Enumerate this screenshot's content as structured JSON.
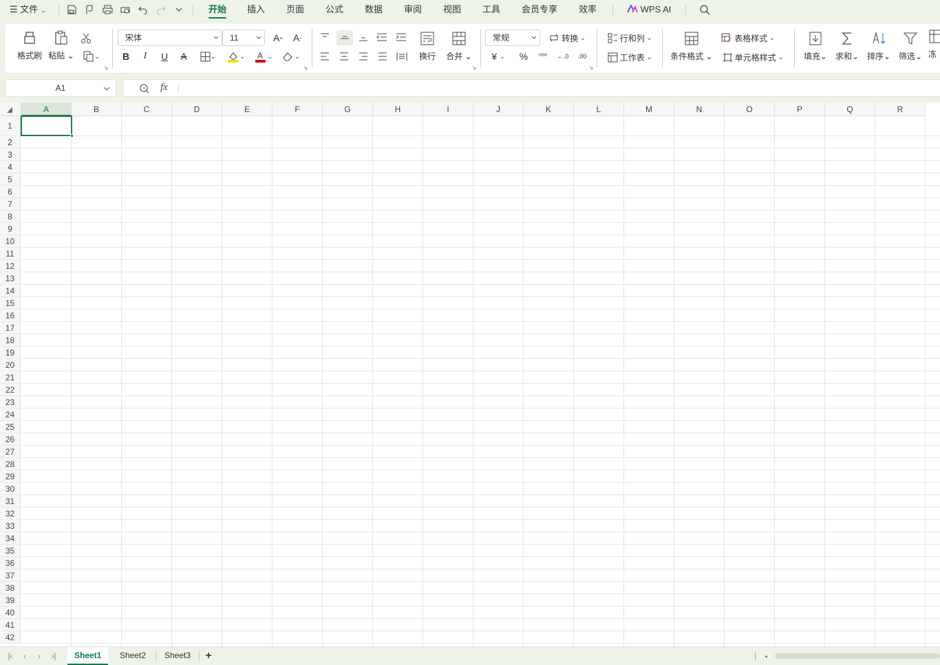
{
  "menu": {
    "file_label": "文件",
    "tabs": [
      "开始",
      "插入",
      "页面",
      "公式",
      "数据",
      "审阅",
      "视图",
      "工具",
      "会员专享",
      "效率"
    ],
    "ai_label": "WPS AI"
  },
  "ribbon": {
    "format_painter": "格式刷",
    "paste": "粘贴",
    "font_name": "宋体",
    "font_size": "11",
    "wrap": "换行",
    "merge": "合并",
    "number_format": "常规",
    "convert": "转换",
    "row_col": "行和列",
    "worksheet": "工作表",
    "cond_format": "条件格式",
    "table_style": "表格样式",
    "cell_style": "单元格样式",
    "fill": "填充",
    "sum": "求和",
    "sort": "排序",
    "filter": "筛选",
    "freeze": "冻",
    "colors": {
      "highlight": "#f5e000",
      "font_color": "#e00000",
      "accent": "#0e7a4a"
    }
  },
  "formula_bar": {
    "cell_ref": "A1",
    "fx": "fx",
    "content": ""
  },
  "sheet": {
    "columns": [
      "A",
      "B",
      "C",
      "D",
      "E",
      "F",
      "G",
      "H",
      "I",
      "J",
      "K",
      "L",
      "M",
      "N",
      "O",
      "P",
      "Q",
      "R"
    ],
    "rows": [
      "1",
      "2",
      "3",
      "4",
      "5",
      "6",
      "7",
      "8",
      "9",
      "10",
      "11",
      "12",
      "13",
      "14",
      "15",
      "16",
      "17",
      "18",
      "19",
      "20",
      "21",
      "22",
      "23",
      "24",
      "25",
      "26",
      "27",
      "28",
      "29",
      "30",
      "31",
      "32",
      "33",
      "34",
      "35",
      "36",
      "37",
      "38",
      "39",
      "40",
      "41",
      "42"
    ],
    "selected_cell": "A1"
  },
  "sheet_tabs": [
    "Sheet1",
    "Sheet2",
    "Sheet3"
  ],
  "add_sheet": "+"
}
